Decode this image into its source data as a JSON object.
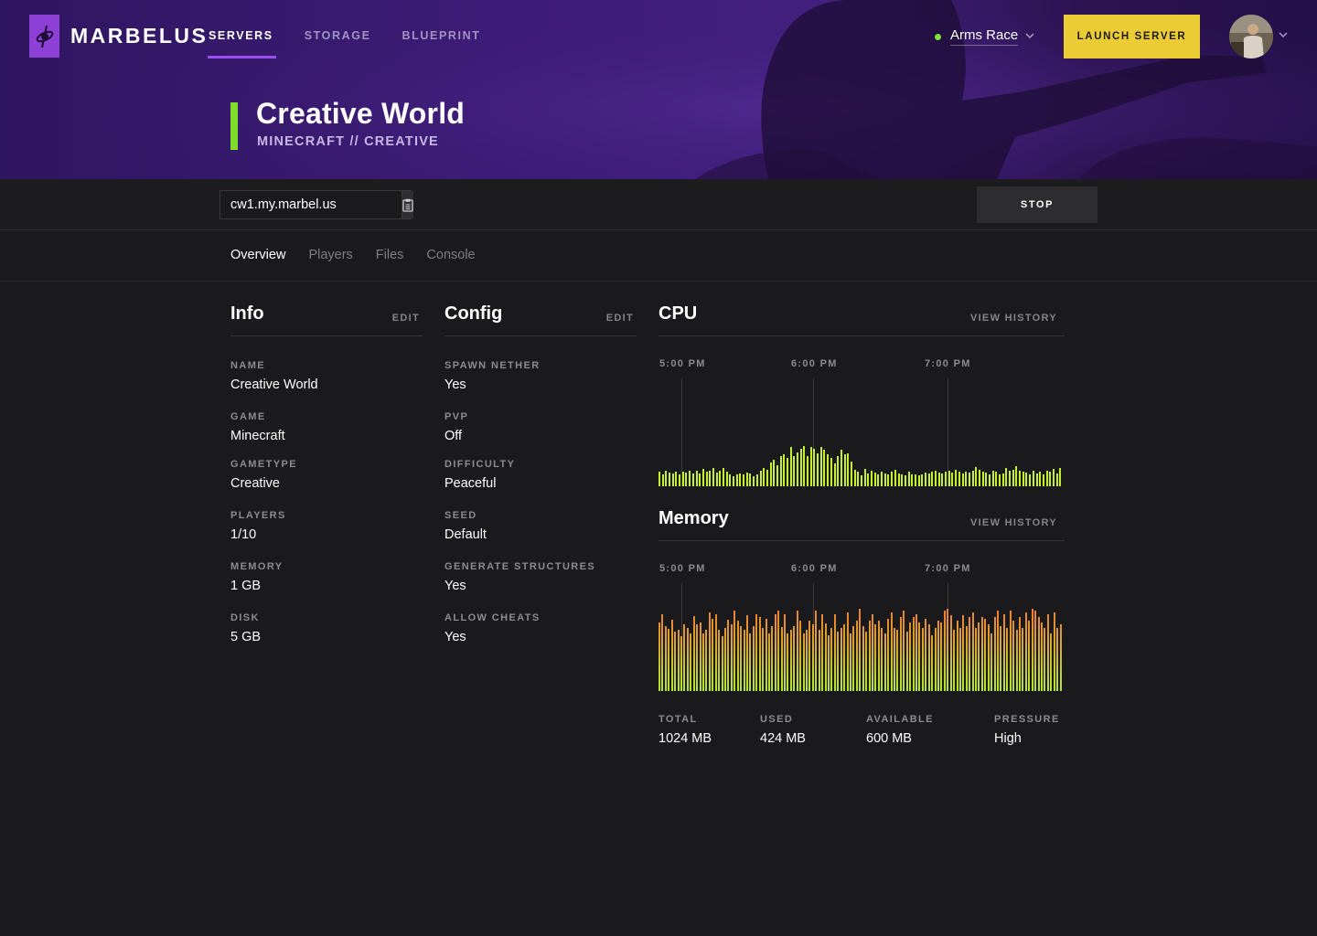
{
  "brand": {
    "name": "MARBELUS"
  },
  "nav": [
    {
      "label": "SERVERS",
      "active": true
    },
    {
      "label": "STORAGE",
      "active": false
    },
    {
      "label": "BLUEPRINT",
      "active": false
    }
  ],
  "team": {
    "name": "Arms Race",
    "status_color": "#7ee335"
  },
  "launch_button": {
    "label": "LAUNCH SERVER"
  },
  "server": {
    "title": "Creative World",
    "subtitle": "MINECRAFT // CREATIVE",
    "address": "cw1.my.marbel.us"
  },
  "stop_button": {
    "label": "STOP"
  },
  "tabs": [
    {
      "label": "Overview",
      "active": true
    },
    {
      "label": "Players",
      "active": false
    },
    {
      "label": "Files",
      "active": false
    },
    {
      "label": "Console",
      "active": false
    }
  ],
  "info": {
    "title": "Info",
    "edit_label": "EDIT",
    "fields": [
      {
        "label": "NAME",
        "value": "Creative World"
      },
      {
        "label": "GAME",
        "value": "Minecraft"
      },
      {
        "label": "GAMETYPE",
        "value": "Creative"
      },
      {
        "label": "PLAYERS",
        "value": "1/10"
      },
      {
        "label": "MEMORY",
        "value": "1 GB"
      },
      {
        "label": "DISK",
        "value": "5 GB"
      }
    ]
  },
  "config": {
    "title": "Config",
    "edit_label": "EDIT",
    "fields": [
      {
        "label": "SPAWN NETHER",
        "value": "Yes"
      },
      {
        "label": "PVP",
        "value": "Off"
      },
      {
        "label": "DIFFICULTY",
        "value": "Peaceful"
      },
      {
        "label": "SEED",
        "value": "Default"
      },
      {
        "label": "GENERATE STRUCTURES",
        "value": "Yes"
      },
      {
        "label": "ALLOW CHEATS",
        "value": "Yes"
      }
    ]
  },
  "cpu": {
    "title": "CPU",
    "history_label": "VIEW HISTORY",
    "time_labels": [
      "5:00 PM",
      "6:00 PM",
      "7:00 PM"
    ],
    "color": "#c6ee2c",
    "values": [
      0.26,
      0.22,
      0.28,
      0.25,
      0.24,
      0.27,
      0.22,
      0.26,
      0.25,
      0.28,
      0.24,
      0.29,
      0.23,
      0.32,
      0.26,
      0.28,
      0.33,
      0.25,
      0.29,
      0.34,
      0.27,
      0.22,
      0.18,
      0.21,
      0.24,
      0.21,
      0.25,
      0.23,
      0.19,
      0.22,
      0.28,
      0.33,
      0.3,
      0.44,
      0.48,
      0.38,
      0.55,
      0.58,
      0.52,
      0.72,
      0.55,
      0.62,
      0.68,
      0.74,
      0.55,
      0.72,
      0.68,
      0.6,
      0.71,
      0.66,
      0.58,
      0.52,
      0.42,
      0.55,
      0.66,
      0.58,
      0.6,
      0.45,
      0.3,
      0.26,
      0.2,
      0.32,
      0.24,
      0.28,
      0.25,
      0.21,
      0.26,
      0.24,
      0.22,
      0.26,
      0.3,
      0.24,
      0.22,
      0.2,
      0.26,
      0.22,
      0.21,
      0.2,
      0.22,
      0.25,
      0.23,
      0.26,
      0.28,
      0.25,
      0.24,
      0.26,
      0.28,
      0.25,
      0.3,
      0.27,
      0.24,
      0.26,
      0.25,
      0.28,
      0.35,
      0.3,
      0.27,
      0.25,
      0.22,
      0.28,
      0.26,
      0.22,
      0.24,
      0.33,
      0.28,
      0.3,
      0.36,
      0.28,
      0.26,
      0.25,
      0.22,
      0.28,
      0.24,
      0.26,
      0.21,
      0.28,
      0.27,
      0.32,
      0.24,
      0.33
    ]
  },
  "memory": {
    "title": "Memory",
    "history_label": "VIEW HISTORY",
    "time_labels": [
      "5:00 PM",
      "6:00 PM",
      "7:00 PM"
    ],
    "color_top": "#f0782b",
    "color_bottom": "#b6e62e",
    "values": [
      0.78,
      0.88,
      0.74,
      0.71,
      0.81,
      0.68,
      0.7,
      0.62,
      0.76,
      0.72,
      0.66,
      0.85,
      0.76,
      0.78,
      0.66,
      0.7,
      0.9,
      0.82,
      0.88,
      0.7,
      0.63,
      0.72,
      0.81,
      0.76,
      0.92,
      0.8,
      0.74,
      0.7,
      0.86,
      0.66,
      0.74,
      0.88,
      0.84,
      0.72,
      0.82,
      0.66,
      0.74,
      0.88,
      0.92,
      0.73,
      0.88,
      0.66,
      0.7,
      0.74,
      0.92,
      0.8,
      0.66,
      0.7,
      0.8,
      0.76,
      0.92,
      0.7,
      0.88,
      0.77,
      0.64,
      0.72,
      0.88,
      0.68,
      0.72,
      0.76,
      0.9,
      0.66,
      0.74,
      0.8,
      0.94,
      0.74,
      0.68,
      0.8,
      0.88,
      0.76,
      0.8,
      0.72,
      0.66,
      0.82,
      0.9,
      0.72,
      0.7,
      0.84,
      0.92,
      0.68,
      0.78,
      0.84,
      0.88,
      0.78,
      0.72,
      0.82,
      0.76,
      0.64,
      0.72,
      0.8,
      0.78,
      0.92,
      0.94,
      0.86,
      0.7,
      0.8,
      0.72,
      0.86,
      0.74,
      0.84,
      0.9,
      0.72,
      0.78,
      0.84,
      0.82,
      0.76,
      0.66,
      0.84,
      0.92,
      0.74,
      0.88,
      0.72,
      0.92,
      0.8,
      0.7,
      0.84,
      0.72,
      0.9,
      0.8,
      0.94,
      0.92,
      0.84,
      0.78,
      0.72,
      0.88,
      0.66,
      0.9,
      0.72,
      0.76
    ]
  },
  "memory_stats": [
    {
      "label": "TOTAL",
      "value": "1024 MB"
    },
    {
      "label": "USED",
      "value": "424 MB"
    },
    {
      "label": "AVAILABLE",
      "value": "600 MB"
    },
    {
      "label": "PRESSURE",
      "value": "High"
    }
  ]
}
